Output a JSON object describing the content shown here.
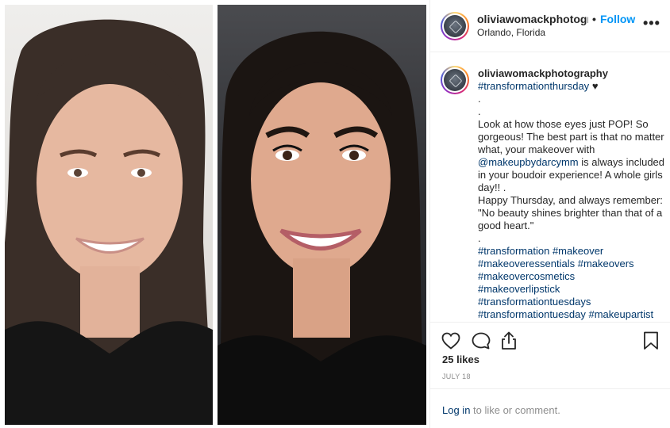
{
  "post": {
    "username": "oliviawomackphotograp",
    "separator": "•",
    "follow_label": "Follow",
    "location": "Orlando, Florida",
    "more_label": "•••"
  },
  "caption": {
    "username": "oliviawomackphotography",
    "hashtag_line": "#transformationthursday",
    "heart": "♥",
    "dot1": ".",
    "dot2": ".",
    "text_1": "Look at how those eyes just POP! So gorgeous! The best part is that no matter what, your makeover with",
    "mention": "@makeupbydarcymm",
    "text_2": " is always included in your boudoir experience! A whole girls day!! .",
    "text_3": "Happy Thursday, and always remember: \"No beauty shines brighter than that of a good heart.\"",
    "dot3": ".",
    "hashtags": [
      "#transformation",
      "#makeover",
      "#makeoveressentials",
      "#makeovers",
      "#makeovercosmetics",
      "#makeoverlipstick",
      "#transformationtuesdays",
      "#transformationtuesday",
      "#makeupartist"
    ]
  },
  "actions": {
    "likes": "25 likes",
    "date": "JULY 18",
    "icons": [
      "heart-icon",
      "comment-icon",
      "share-icon",
      "bookmark-icon"
    ]
  },
  "login": {
    "link": "Log in",
    "rest": "to like or comment."
  }
}
